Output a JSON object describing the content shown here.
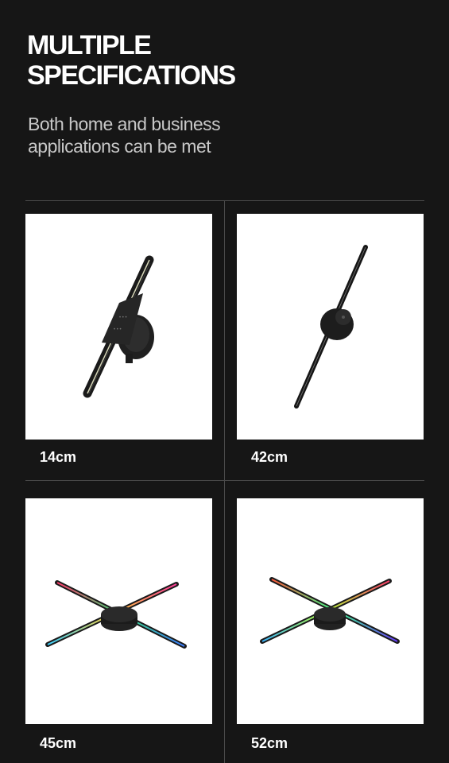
{
  "header": {
    "title_line1": "MULTIPLE",
    "title_line2": "SPECIFICATIONS",
    "subtitle_line1": "Both home and business",
    "subtitle_line2": "applications can be met"
  },
  "products": [
    {
      "size_label": "14cm"
    },
    {
      "size_label": "42cm"
    },
    {
      "size_label": "45cm"
    },
    {
      "size_label": "52cm"
    }
  ]
}
